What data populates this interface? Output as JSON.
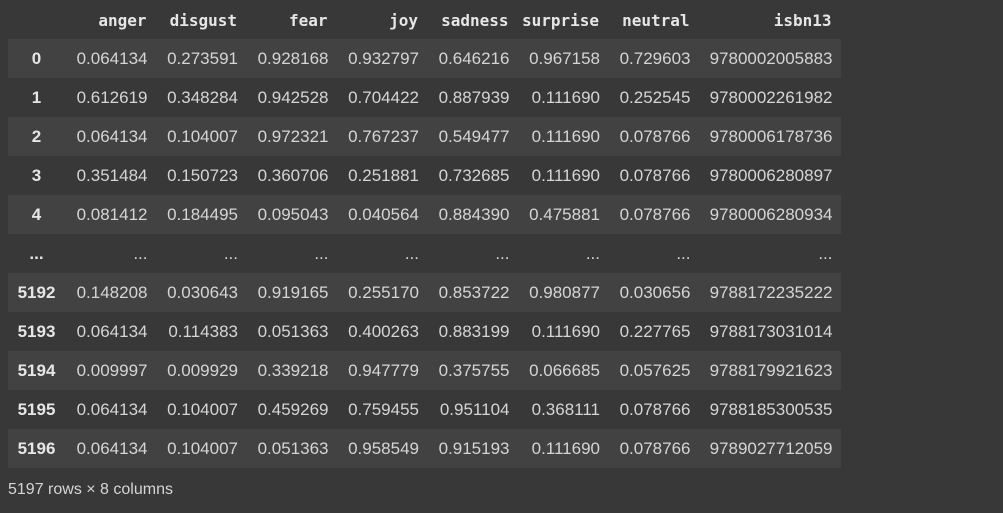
{
  "dataframe": {
    "columns": [
      "anger",
      "disgust",
      "fear",
      "joy",
      "sadness",
      "surprise",
      "neutral",
      "isbn13"
    ],
    "rows": [
      {
        "index": "0",
        "cells": [
          "0.064134",
          "0.273591",
          "0.928168",
          "0.932797",
          "0.646216",
          "0.967158",
          "0.729603",
          "9780002005883"
        ]
      },
      {
        "index": "1",
        "cells": [
          "0.612619",
          "0.348284",
          "0.942528",
          "0.704422",
          "0.887939",
          "0.111690",
          "0.252545",
          "9780002261982"
        ]
      },
      {
        "index": "2",
        "cells": [
          "0.064134",
          "0.104007",
          "0.972321",
          "0.767237",
          "0.549477",
          "0.111690",
          "0.078766",
          "9780006178736"
        ]
      },
      {
        "index": "3",
        "cells": [
          "0.351484",
          "0.150723",
          "0.360706",
          "0.251881",
          "0.732685",
          "0.111690",
          "0.078766",
          "9780006280897"
        ]
      },
      {
        "index": "4",
        "cells": [
          "0.081412",
          "0.184495",
          "0.095043",
          "0.040564",
          "0.884390",
          "0.475881",
          "0.078766",
          "9780006280934"
        ]
      },
      {
        "index": "...",
        "cells": [
          "...",
          "...",
          "...",
          "...",
          "...",
          "...",
          "...",
          "..."
        ]
      },
      {
        "index": "5192",
        "cells": [
          "0.148208",
          "0.030643",
          "0.919165",
          "0.255170",
          "0.853722",
          "0.980877",
          "0.030656",
          "9788172235222"
        ]
      },
      {
        "index": "5193",
        "cells": [
          "0.064134",
          "0.114383",
          "0.051363",
          "0.400263",
          "0.883199",
          "0.111690",
          "0.227765",
          "9788173031014"
        ]
      },
      {
        "index": "5194",
        "cells": [
          "0.009997",
          "0.009929",
          "0.339218",
          "0.947779",
          "0.375755",
          "0.066685",
          "0.057625",
          "9788179921623"
        ]
      },
      {
        "index": "5195",
        "cells": [
          "0.064134",
          "0.104007",
          "0.459269",
          "0.759455",
          "0.951104",
          "0.368111",
          "0.078766",
          "9788185300535"
        ]
      },
      {
        "index": "5196",
        "cells": [
          "0.064134",
          "0.104007",
          "0.051363",
          "0.958549",
          "0.915193",
          "0.111690",
          "0.078766",
          "9789027712059"
        ]
      }
    ],
    "summary": "5197 rows × 8 columns"
  },
  "colors": {
    "background": "#383838",
    "stripe": "#424242",
    "text": "#d5d5d5",
    "header_text": "#e6e6e6"
  }
}
